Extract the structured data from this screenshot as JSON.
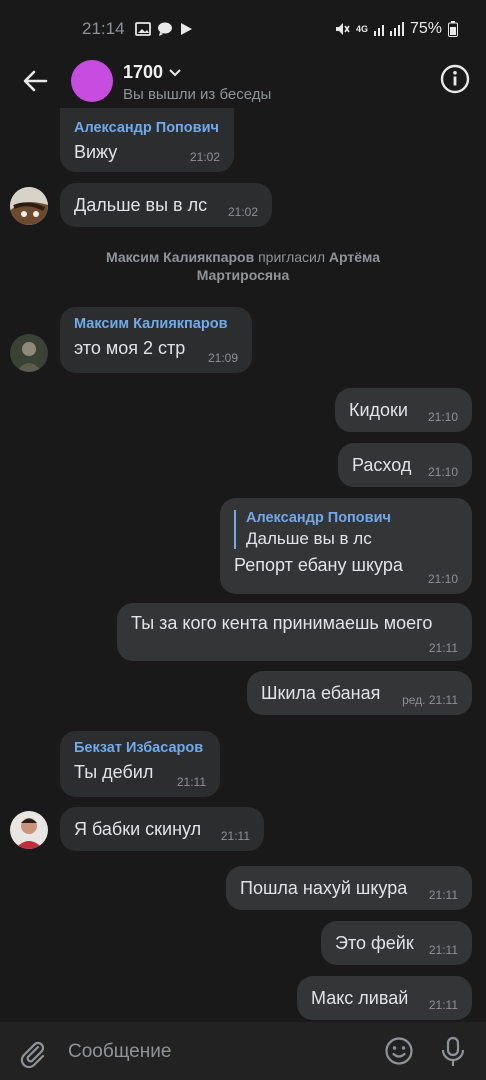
{
  "status": {
    "time": "21:14",
    "battery": "75%",
    "network": "4G"
  },
  "header": {
    "title": "1700",
    "subtitle": "Вы вышли из беседы"
  },
  "colors": {
    "accent": "#71aaeb",
    "avatar": "#c64de0",
    "bubble_in": "#2c2d2e",
    "bubble_out": "#333537",
    "bg": "#19191a"
  },
  "messages": [
    {
      "sender": "Александр Попович",
      "text": "Вижу",
      "time": "21:02"
    },
    {
      "text": "Дальше вы в лс",
      "time": "21:02"
    },
    {
      "service_name1": "Максим Калиякпаров",
      "service_action": "пригласил",
      "service_name2": "Артёма Мартиросяна"
    },
    {
      "sender": "Максим Калиякпаров",
      "text": "это моя 2 стр",
      "time": "21:09"
    },
    {
      "text": "Кидоки",
      "time": "21:10"
    },
    {
      "text": "Расход",
      "time": "21:10"
    },
    {
      "reply_name": "Александр Попович",
      "reply_text": "Дальше вы в лс",
      "text": "Репорт ебану шкура",
      "time": "21:10"
    },
    {
      "text": "Ты за кого кента принимаешь моего",
      "time": "21:11"
    },
    {
      "text": "Шкила ебаная",
      "time": "ред. 21:11"
    },
    {
      "sender": "Бекзат Избасаров",
      "text": "Ты дебил",
      "time": "21:11"
    },
    {
      "text": "Я бабки скинул",
      "time": "21:11"
    },
    {
      "text": "Пошла нахуй шкура",
      "time": "21:11"
    },
    {
      "text": "Это фейк",
      "time": "21:11"
    },
    {
      "text": "Макс ливай",
      "time": "21:11"
    }
  ],
  "composer": {
    "placeholder": "Сообщение"
  }
}
